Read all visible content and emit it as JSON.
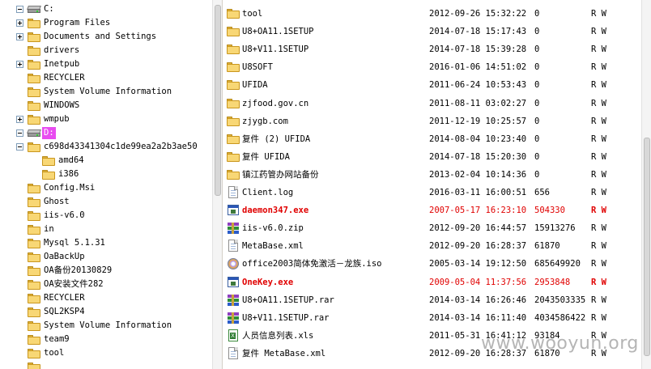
{
  "tree": {
    "items": [
      {
        "label": "C:",
        "kind": "drive",
        "expander": "minus",
        "selected": false
      },
      {
        "label": "Program Files",
        "kind": "folder",
        "expander": "plus"
      },
      {
        "label": "Documents and Settings",
        "kind": "folder",
        "expander": "plus"
      },
      {
        "label": "drivers",
        "kind": "folder",
        "expander": ""
      },
      {
        "label": "Inetpub",
        "kind": "folder",
        "expander": "plus"
      },
      {
        "label": "RECYCLER",
        "kind": "folder",
        "expander": ""
      },
      {
        "label": "System Volume Information",
        "kind": "folder",
        "expander": ""
      },
      {
        "label": "WINDOWS",
        "kind": "folder",
        "expander": ""
      },
      {
        "label": "wmpub",
        "kind": "folder",
        "expander": "plus"
      },
      {
        "label": "D:",
        "kind": "drive",
        "expander": "minus",
        "selected": true
      },
      {
        "label": "c698d43341304c1de99ea2a2b3ae50",
        "kind": "folder",
        "expander": "minus"
      },
      {
        "label": "amd64",
        "kind": "folder",
        "expander": ""
      },
      {
        "label": "i386",
        "kind": "folder",
        "expander": ""
      },
      {
        "label": "Config.Msi",
        "kind": "folder",
        "expander": ""
      },
      {
        "label": "Ghost",
        "kind": "folder",
        "expander": ""
      },
      {
        "label": "iis-v6.0",
        "kind": "folder",
        "expander": ""
      },
      {
        "label": "in",
        "kind": "folder",
        "expander": ""
      },
      {
        "label": "Mysql 5.1.31",
        "kind": "folder",
        "expander": ""
      },
      {
        "label": "OaBackUp",
        "kind": "folder",
        "expander": ""
      },
      {
        "label": "OA备份20130829",
        "kind": "folder",
        "expander": ""
      },
      {
        "label": "OA安装文件282",
        "kind": "folder",
        "expander": ""
      },
      {
        "label": "RECYCLER",
        "kind": "folder",
        "expander": ""
      },
      {
        "label": "SQL2KSP4",
        "kind": "folder",
        "expander": ""
      },
      {
        "label": "System Volume Information",
        "kind": "folder",
        "expander": ""
      },
      {
        "label": "team9",
        "kind": "folder",
        "expander": ""
      },
      {
        "label": "tool",
        "kind": "folder",
        "expander": ""
      },
      {
        "label": "",
        "kind": "folder",
        "expander": ""
      }
    ],
    "scroll_position": 0.46
  },
  "files": [
    {
      "name": "tool",
      "date": "2012-09-26 15:32:22",
      "size": "0",
      "attr": "R W",
      "icon": "folder-icon",
      "highlight": false
    },
    {
      "name": "U8+OA11.1SETUP",
      "date": "2014-07-18 15:17:43",
      "size": "0",
      "attr": "R W",
      "icon": "folder-icon",
      "highlight": false
    },
    {
      "name": "U8+V11.1SETUP",
      "date": "2014-07-18 15:39:28",
      "size": "0",
      "attr": "R W",
      "icon": "folder-icon",
      "highlight": false
    },
    {
      "name": "U8SOFT",
      "date": "2016-01-06 14:51:02",
      "size": "0",
      "attr": "R W",
      "icon": "folder-icon",
      "highlight": false
    },
    {
      "name": "UFIDA",
      "date": "2011-06-24 10:53:43",
      "size": "0",
      "attr": "R W",
      "icon": "folder-icon",
      "highlight": false
    },
    {
      "name": "zjfood.gov.cn",
      "date": "2011-08-11 03:02:27",
      "size": "0",
      "attr": "R W",
      "icon": "folder-icon",
      "highlight": false
    },
    {
      "name": "zjygb.com",
      "date": "2011-12-19 10:25:57",
      "size": "0",
      "attr": "R W",
      "icon": "folder-icon",
      "highlight": false
    },
    {
      "name": "复件 (2) UFIDA",
      "date": "2014-08-04 10:23:40",
      "size": "0",
      "attr": "R W",
      "icon": "folder-icon",
      "highlight": false
    },
    {
      "name": "复件 UFIDA",
      "date": "2014-07-18 15:20:30",
      "size": "0",
      "attr": "R W",
      "icon": "folder-icon",
      "highlight": false
    },
    {
      "name": "镇江药管办网站备份",
      "date": "2013-02-04 10:14:36",
      "size": "0",
      "attr": "R W",
      "icon": "folder-icon",
      "highlight": false
    },
    {
      "name": "Client.log",
      "date": "2016-03-11 16:00:51",
      "size": "656",
      "attr": "R W",
      "icon": "document-icon",
      "highlight": false
    },
    {
      "name": "daemon347.exe",
      "date": "2007-05-17 16:23:10",
      "size": "504330",
      "attr": "R W",
      "icon": "executable-icon",
      "highlight": true
    },
    {
      "name": "iis-v6.0.zip",
      "date": "2012-09-20 16:44:57",
      "size": "15913276",
      "attr": "R W",
      "icon": "archive-icon",
      "highlight": false
    },
    {
      "name": "MetaBase.xml",
      "date": "2012-09-20 16:28:37",
      "size": "61870",
      "attr": "R W",
      "icon": "document-icon",
      "highlight": false
    },
    {
      "name": "office2003简体免激活－龙族.iso",
      "date": "2005-03-14 19:12:50",
      "size": "685649920",
      "attr": "R W",
      "icon": "disc-image-icon",
      "highlight": false
    },
    {
      "name": "OneKey.exe",
      "date": "2009-05-04 11:37:56",
      "size": "2953848",
      "attr": "R W",
      "icon": "executable-icon",
      "highlight": true
    },
    {
      "name": "U8+OA11.1SETUP.rar",
      "date": "2014-03-14 16:26:46",
      "size": "2043503335",
      "attr": "R W",
      "icon": "archive-icon",
      "highlight": false
    },
    {
      "name": "U8+V11.1SETUP.rar",
      "date": "2014-03-14 16:11:40",
      "size": "4034586422",
      "attr": "R W",
      "icon": "archive-icon",
      "highlight": false
    },
    {
      "name": "人员信息列表.xls",
      "date": "2011-05-31 16:41:12",
      "size": "93184",
      "attr": "R W",
      "icon": "spreadsheet-icon",
      "highlight": false
    },
    {
      "name": "复件 MetaBase.xml",
      "date": "2012-09-20 16:28:37",
      "size": "61870",
      "attr": "R W",
      "icon": "document-icon",
      "highlight": false
    }
  ],
  "list_scroll_position": 0.43,
  "watermark": "www.wooyun.org",
  "colors": {
    "selected_drive_bg": "#e84cf0",
    "highlight_text": "#e00000",
    "folder": "#f8d775"
  }
}
